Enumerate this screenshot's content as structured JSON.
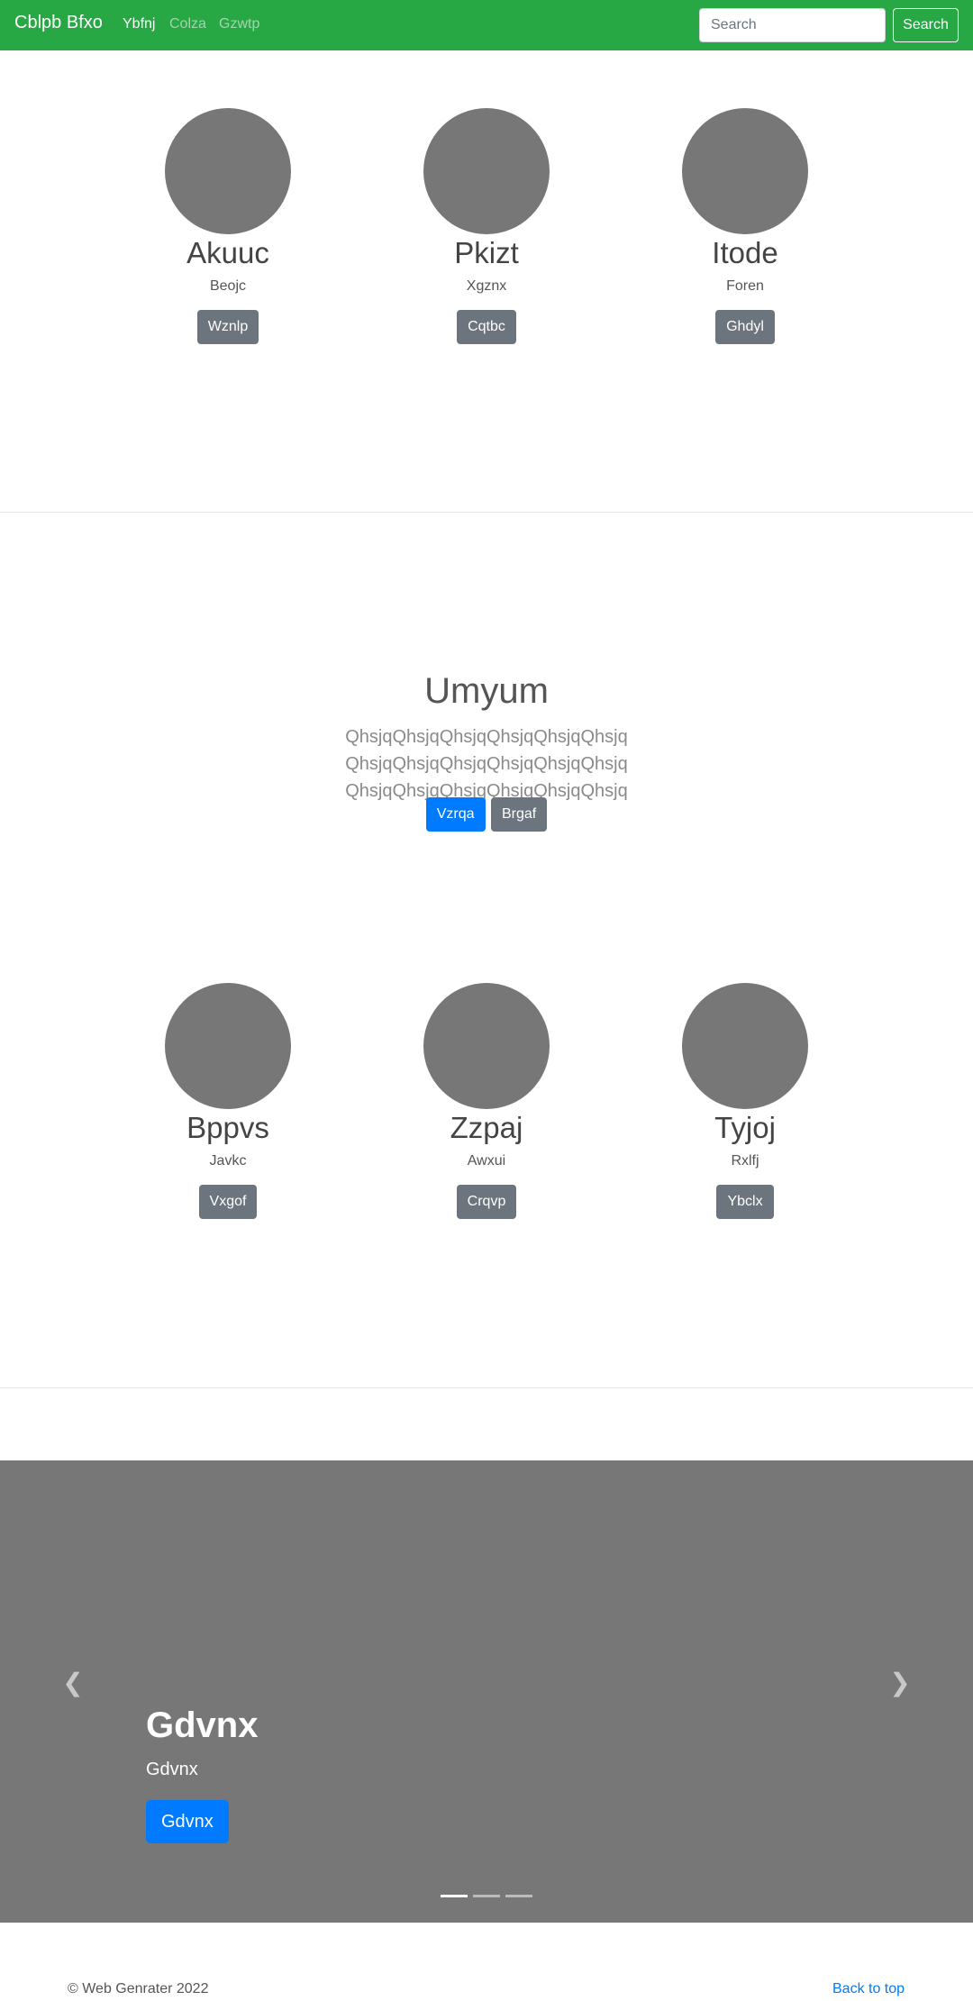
{
  "navbar": {
    "brand": "Cblpb Bfxo",
    "links": [
      "Ybfnj",
      "Colza",
      "Gzwtp"
    ],
    "search_placeholder": "Search",
    "search_button": "Search"
  },
  "team_top": [
    {
      "name": "Akuuc",
      "sub": "Beojc",
      "button": "Wznlp"
    },
    {
      "name": "Pkizt",
      "sub": "Xgznx",
      "button": "Cqtbc"
    },
    {
      "name": "Itode",
      "sub": "Foren",
      "button": "Ghdyl"
    }
  ],
  "hero": {
    "title": "Umyum",
    "lead": "QhsjqQhsjqQhsjqQhsjqQhsjqQhsjq QhsjqQhsjqQhsjqQhsjqQhsjqQhsjq QhsjqQhsjqQhsjqQhsjqQhsjqQhsjq",
    "primary_button": "Vzrqa",
    "secondary_button": "Brgaf"
  },
  "team_bottom": [
    {
      "name": "Bppvs",
      "sub": "Javkc",
      "button": "Vxgof"
    },
    {
      "name": "Zzpaj",
      "sub": "Awxui",
      "button": "Crqvp"
    },
    {
      "name": "Tyjoj",
      "sub": "Rxlfj",
      "button": "Ybclx"
    }
  ],
  "carousel": {
    "title": "Gdvnx",
    "subtitle": "Gdvnx",
    "button": "Gdvnx",
    "prev_icon": "chevron-left-icon",
    "next_icon": "chevron-right-icon",
    "slides": 3,
    "active_slide": 1
  },
  "footer": {
    "copyright": "© Web Genrater 2022",
    "back_to_top": "Back to top"
  },
  "colors": {
    "navbar": "#28a745",
    "primary": "#007bff",
    "secondary": "#6c757d",
    "placeholder": "#777777"
  }
}
